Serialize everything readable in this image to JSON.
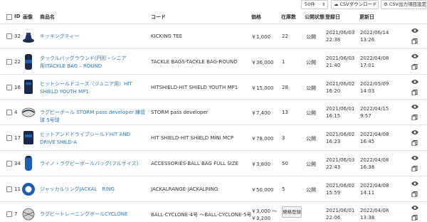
{
  "toolbar": {
    "per_page": "50件",
    "csv_download": "CSVダウンロード",
    "csv_settings": "CSV出力項目設定"
  },
  "columns": {
    "id": "ID",
    "image": "画像",
    "name": "商品名",
    "code": "コード",
    "price": "価格",
    "stock": "在庫数",
    "status": "公開状態",
    "registered": "登録日",
    "updated": "更新日"
  },
  "rows": [
    {
      "id": "32",
      "name": "キッキングティー",
      "code": "KICKING TEE",
      "price": "￥1,000",
      "stock": "22",
      "status": "公開",
      "reg_date": "2021/06/03",
      "reg_time": "22:38",
      "upd_date": "2022/06/14",
      "upd_time": "13:26"
    },
    {
      "id": "22",
      "name": "タックルバッグラウンド(円形・シニア用)TACKLE BAG – ROUND",
      "code": "TACKLE BAGS-TACKLE BAG-ROUND",
      "price": "￥36,000",
      "stock": "1",
      "status": "公開",
      "reg_date": "2021/06/03",
      "reg_time": "21:40",
      "upd_date": "2022/04/08",
      "upd_time": "17:01"
    },
    {
      "id": "16",
      "name": "ヒットシールドユース（ジュニア用）HIT SHIELD YOUTH MP1",
      "code": "HITSHIELD-HIT SHIELD YOUTH MP1",
      "price": "￥15,000",
      "stock": "28",
      "status": "公開",
      "reg_date": "2021/06/02",
      "reg_time": "16:20",
      "upd_date": "2022/05/09",
      "upd_time": "14:03"
    },
    {
      "id": "4",
      "name": "ラグビーボール STORM pass developer 練習球 5号球",
      "code": "STORM pass developer",
      "price": "￥7,400",
      "stock": "13",
      "status": "公開",
      "reg_date": "2021/06/01",
      "reg_time": "16:15",
      "upd_date": "2022/04/15",
      "upd_time": "9:57"
    },
    {
      "id": "17",
      "name": "ヒットアンドドライブシールドHIT AND DRIVE SHILD-A",
      "code": "HIT SHIELD-HIT SHIELD MINI MCP",
      "price": "￥78,000",
      "stock": "3",
      "status": "公開",
      "reg_date": "2021/06/02",
      "reg_time": "16:23",
      "upd_date": "2022/04/08",
      "upd_time": "16:45"
    },
    {
      "id": "34",
      "name": "ライノ・ラグビーボールバッグ(フルサイズ)",
      "code": "ACCESSORIES-BALL BAG FULL SIZE",
      "price": "￥3,800",
      "stock": "50",
      "status": "公開",
      "reg_date": "2021/06/03",
      "reg_time": "22:43",
      "upd_date": "2022/04/08",
      "upd_time": "16:38"
    },
    {
      "id": "11",
      "name": "ジャッカルリングJACKAL　RING",
      "code": "JACKALRANGE-JACKALRING",
      "price": "￥50,000",
      "stock": "5",
      "status": "公開",
      "reg_date": "2021/06/02",
      "reg_time": "15:59",
      "upd_date": "2022/04/08",
      "upd_time": "14:11"
    },
    {
      "id": "7",
      "name": "ラグビートレーニングボールCYCLONE",
      "code": "BALL-CYCLONE-4号 ～BALL-CYCLONE-5号",
      "price": "￥3,000 ～",
      "price2": "￥3,200",
      "stock": "",
      "status": "",
      "status_btn": "規格登録",
      "reg_date": "2021/06/01",
      "reg_time": "22:06",
      "upd_date": "2022/04/08",
      "upd_time": "13:38"
    }
  ],
  "icons": {
    "view": "eye-icon",
    "copy": "copy-icon",
    "upload": "cloud-upload-icon",
    "gear": "gear-icon"
  },
  "colors": {
    "link": "#2a7ab8",
    "thumb_dark": "#1b2a4a",
    "thumb_blue": "#1e5fb0"
  }
}
